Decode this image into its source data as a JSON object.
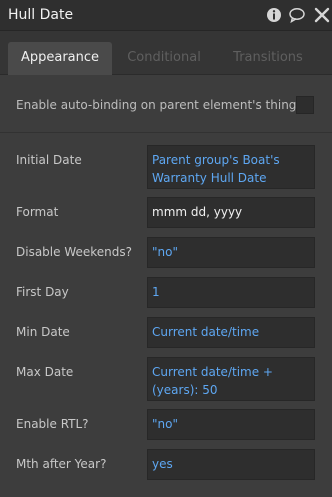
{
  "header": {
    "title": "Hull Date",
    "icons": [
      "info-icon",
      "comment-icon",
      "close-icon"
    ]
  },
  "tabs": [
    {
      "label": "Appearance",
      "active": true
    },
    {
      "label": "Conditional",
      "active": false
    },
    {
      "label": "Transitions",
      "active": false
    }
  ],
  "autobind": {
    "label": "Enable auto-binding on parent element's thing",
    "checked": false
  },
  "props": [
    {
      "label": "Initial Date",
      "value": "Parent group's Boat's Warranty Hull Date"
    },
    {
      "label": "Format",
      "value": "mmm dd, yyyy"
    },
    {
      "label": "Disable Weekends?",
      "value": "\"no\""
    },
    {
      "label": "First Day",
      "value": "1"
    },
    {
      "label": "Min Date",
      "value": "Current date/time"
    },
    {
      "label": "Max Date",
      "value": "Current date/time +(years): 50"
    },
    {
      "label": "Enable RTL?",
      "value": "\"no\""
    },
    {
      "label": "Mth after Year?",
      "value": "yes"
    }
  ],
  "colors": {
    "dynamic_value": "#5ea7f2",
    "panel_bg": "#3d3d3d",
    "field_bg": "#2e2e2e"
  }
}
